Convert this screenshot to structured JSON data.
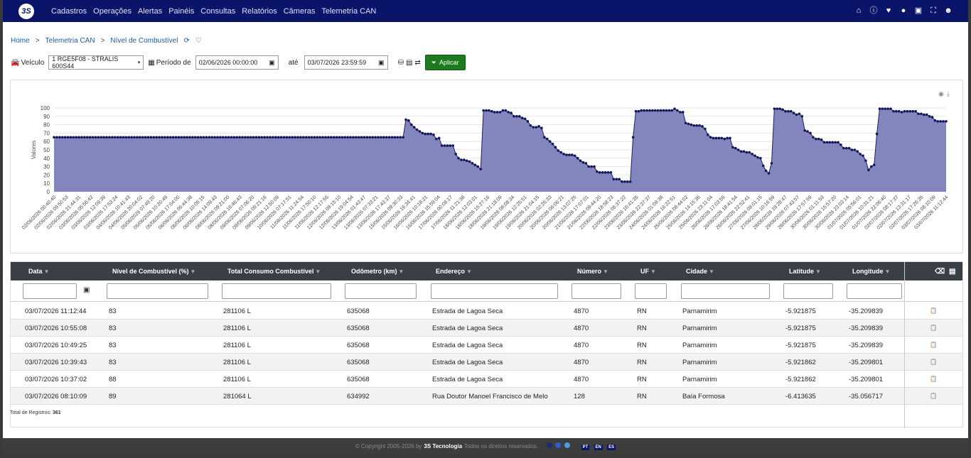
{
  "app": {
    "logo_text": "3S"
  },
  "nav": [
    "Cadastros",
    "Operações",
    "Alertas",
    "Painéis",
    "Consultas",
    "Relatórios",
    "Câmeras",
    "Telemetria CAN"
  ],
  "top_icons": [
    "home-icon",
    "info-icon",
    "heart-icon",
    "chat-icon",
    "inbox-icon",
    "fullscreen-icon",
    "user-icon"
  ],
  "breadcrumb": {
    "home": "Home",
    "section": "Telemetria CAN",
    "page": "Nível de Combustível"
  },
  "filters": {
    "vehicle_label": "Veículo",
    "vehicle_value": "1 RGE5F08 - STRALIS 600S44",
    "period_label": "Período de",
    "date_from": "02/06/2026 00:00:00",
    "until_label": "até",
    "date_to": "03/07/2026 23:59:59",
    "apply_label": "Aplicar"
  },
  "chart_data": {
    "type": "area",
    "ylabel": "Valores",
    "xlabel": "",
    "ylim": [
      0,
      100
    ],
    "yticks": [
      0,
      10,
      20,
      30,
      40,
      50,
      60,
      70,
      80,
      90,
      100
    ],
    "color": "#7b7fb8",
    "x_tick_labels": [
      "02/06/2026 00:40:40",
      "02/06/2026 09:50:53",
      "02/06/2026 21:44:31",
      "03/06/2026 05:56:42",
      "03/06/2026 12:09:39",
      "03/06/2026 17:53:24",
      "04/06/2026 10:41:43",
      "04/06/2026 20:04:02",
      "05/06/2026 07:49:20",
      "05/06/2026 10:20:49",
      "05/06/2026 17:04:00",
      "06/06/2026 06:44:38",
      "06/06/2026 10:05:15",
      "06/06/2026 14:09:43",
      "08/06/2026 09:21:00",
      "08/06/2026 16:46:43",
      "09/06/2026 07:06:20",
      "09/06/2026 09:21:16",
      "09/06/2026 12:50:09",
      "10/06/2026 07:17:51",
      "11/06/2026 11:24:54",
      "11/06/2026 17:50:10",
      "11/06/2026 12:17:55",
      "12/06/2026 09:15:10",
      "12/06/2026 19:04:54",
      "13/06/2026 01:43:47",
      "13/06/2026 07:33:21",
      "13/06/2026 17:43:37",
      "15/06/2026 09:30:33",
      "15/06/2026 16:34:41",
      "16/06/2026 10:18:21",
      "16/06/2026 15:59:04",
      "17/06/2026 00:08:17",
      "17/06/2026 11:21:38",
      "18/06/2026 12:03:01",
      "18/06/2026 15:27:16",
      "18/06/2026 21:18:09",
      "19/06/2026 08:08:34",
      "19/06/2026 12:25:51",
      "19/06/2026 21:04:15",
      "20/06/2026 02:26:33",
      "20/06/2026 06:06:21",
      "20/06/2026 13:07:25",
      "21/06/2026 17:07:01",
      "21/06/2026 09:44:20",
      "22/06/2026 18:58:23",
      "22/06/2026 06:37:22",
      "23/06/2026 16:41:35",
      "23/06/2026 22:37:37",
      "24/06/2026 01:09:38",
      "24/06/2026 16:22:51",
      "25/06/2026 08:44:02",
      "25/06/2026 14:15:36",
      "25/06/2026 23:11:04",
      "26/06/2026 17:03:55",
      "26/06/2026 18:41:54",
      "26/06/2026 22:52:41",
      "27/06/2026 08:01:15",
      "27/06/2026 10:16:59",
      "28/06/2026 19:28:47",
      "29/06/2026 07:43:57",
      "29/06/2026 17:57:59",
      "30/06/2026 01:11:53",
      "30/06/2026 15:57:20",
      "30/06/2026 23:03:14",
      "01/07/2026 05:56:01",
      "01/07/2026 10:31:21",
      "01/07/2026 22:06:40",
      "02/07/2026 08:17:37",
      "02/07/2026 13:31:17",
      "02/07/2026 17:26:35",
      "03/07/2026 08:10:09",
      "03/07/2026 11:12:44"
    ],
    "series": [
      {
        "values": [
          65,
          65,
          65,
          65,
          65,
          65,
          65,
          65,
          65,
          65,
          65,
          65,
          65,
          65,
          65,
          65,
          65,
          65,
          65,
          65,
          65,
          65,
          65,
          65,
          65,
          65,
          65,
          65,
          65,
          65,
          65,
          65,
          65,
          65,
          65,
          65,
          65,
          65,
          65,
          65,
          65,
          65,
          65,
          65,
          65,
          65,
          65,
          65,
          65,
          65,
          65,
          65,
          65,
          65,
          65,
          65,
          65,
          65,
          65,
          65,
          65,
          65,
          65,
          65,
          65,
          65,
          65,
          65,
          65,
          65,
          65,
          65,
          65,
          65,
          65,
          65,
          65,
          65,
          65,
          65,
          65,
          65,
          65,
          65,
          65,
          65,
          65,
          65,
          65,
          65,
          65,
          65,
          65,
          65,
          65,
          65,
          65,
          65,
          65,
          65,
          65,
          65,
          65,
          65,
          65,
          65,
          65,
          65,
          65,
          65,
          65,
          65,
          65,
          65,
          65,
          65,
          65,
          65,
          65,
          65,
          65,
          65,
          65,
          65,
          65,
          65,
          65,
          86,
          85,
          80,
          77,
          74,
          72,
          70,
          69,
          69,
          69,
          68,
          63,
          64,
          55,
          55,
          55,
          55,
          55,
          45,
          40,
          38,
          38,
          37,
          36,
          34,
          32,
          30,
          27,
          97,
          97,
          97,
          96,
          95,
          95,
          95,
          97,
          97,
          95,
          94,
          90,
          90,
          90,
          88,
          87,
          84,
          79,
          77,
          77,
          78,
          76,
          65,
          63,
          60,
          57,
          53,
          49,
          47,
          45,
          44,
          44,
          44,
          43,
          40,
          37,
          35,
          34,
          30,
          30,
          30,
          24,
          23,
          23,
          23,
          23,
          23,
          15,
          15,
          15,
          12,
          12,
          12,
          12,
          65,
          96,
          96,
          97,
          97,
          97,
          97,
          97,
          97,
          97,
          97,
          97,
          97,
          97,
          97,
          99,
          97,
          95,
          95,
          82,
          81,
          80,
          79,
          79,
          79,
          78,
          75,
          68,
          65,
          64,
          64,
          64,
          64,
          63,
          64,
          64,
          53,
          52,
          50,
          48,
          48,
          47,
          47,
          45,
          43,
          41,
          40,
          31,
          25,
          22,
          34,
          99,
          99,
          99,
          98,
          96,
          96,
          96,
          94,
          92,
          93,
          90,
          73,
          72,
          70,
          65,
          63,
          63,
          62,
          59,
          59,
          59,
          59,
          59,
          59,
          56,
          52,
          52,
          52,
          50,
          50,
          48,
          45,
          43,
          37,
          26,
          30,
          32,
          69,
          99,
          99,
          99,
          99,
          99,
          96,
          96,
          96,
          95,
          96,
          96,
          96,
          96,
          96,
          93,
          93,
          92,
          92,
          90,
          89,
          85,
          84,
          84,
          84,
          84
        ]
      }
    ]
  },
  "table": {
    "headers": [
      "Data",
      "Nível de Combustível (%)",
      "Total Consumo Combustível",
      "Odômetro (km)",
      "Endereço",
      "Número",
      "UF",
      "Cidade",
      "Latitude",
      "Longitude"
    ],
    "rows": [
      [
        "03/07/2026 11:12:44",
        "83",
        "281106 L",
        "635068",
        "Estrada de Lagoa Seca",
        "4870",
        "RN",
        "Parnamirim",
        "-5.921875",
        "-35.209839"
      ],
      [
        "03/07/2026 10:55:08",
        "83",
        "281106 L",
        "635068",
        "Estrada de Lagoa Seca",
        "4870",
        "RN",
        "Parnamirim",
        "-5.921875",
        "-35.209839"
      ],
      [
        "03/07/2026 10:49:25",
        "83",
        "281106 L",
        "635068",
        "Estrada de Lagoa Seca",
        "4870",
        "RN",
        "Parnamirim",
        "-5.921875",
        "-35.209839"
      ],
      [
        "03/07/2026 10:39:43",
        "83",
        "281106 L",
        "635068",
        "Estrada de Lagoa Seca",
        "4870",
        "RN",
        "Parnamirim",
        "-5.921862",
        "-35.209801"
      ],
      [
        "03/07/2026 10:37:02",
        "88",
        "281106 L",
        "635068",
        "Estrada de Lagoa Seca",
        "4870",
        "RN",
        "Parnamirim",
        "-5.921862",
        "-35.209801"
      ],
      [
        "03/07/2026 08:10:09",
        "89",
        "281064 L",
        "634992",
        "Rua Doutor Manoel Francisco de Melo",
        "128",
        "RN",
        "Baía Formosa",
        "-6.413635",
        "-35.056717"
      ]
    ],
    "total_label": "Total de Registros:",
    "total_value": "361"
  },
  "footer": {
    "copyright": "© Copyright 2005-2026 by",
    "company": "3S Tecnologia",
    "rights": "Todos os direitos reservados.",
    "langs": [
      "PT",
      "EN",
      "ES"
    ]
  }
}
